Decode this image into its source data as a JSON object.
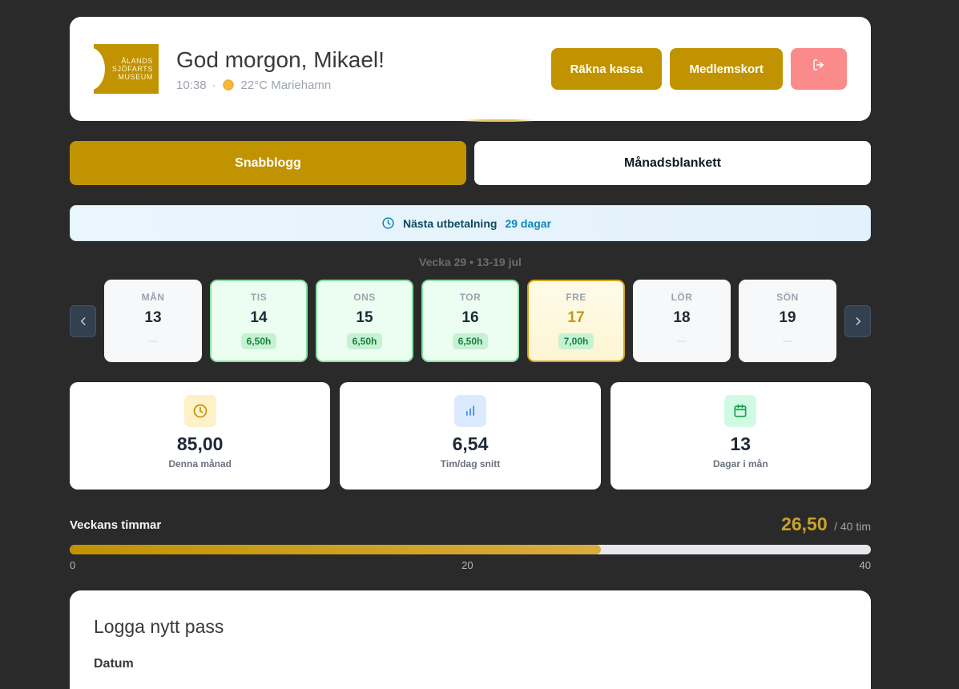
{
  "header": {
    "logo_lines": [
      "ÅLANDS",
      "SJÖFARTS",
      "MUSEUM"
    ],
    "greeting": "God morgon, Mikael!",
    "time": "10:38",
    "separator": "·",
    "weather": "22°C Mariehamn",
    "weather_icon": "sun-icon",
    "buttons": {
      "count_register": "Räkna kassa",
      "member_card": "Medlemskort"
    },
    "logout_icon": "logout-icon"
  },
  "tabs": [
    {
      "label": "Snabblogg",
      "active": true
    },
    {
      "label": "Månadsblankett",
      "active": false
    }
  ],
  "payout": {
    "label": "Nästa utbetalning",
    "days": "29 dagar"
  },
  "week": {
    "title": "Vecka 29 • 13-19 jul",
    "days": [
      {
        "name": "MÅN",
        "num": "13",
        "hours": "",
        "state": "empty",
        "empty": "—"
      },
      {
        "name": "TIS",
        "num": "14",
        "hours": "6,50h",
        "state": "logged",
        "empty": ""
      },
      {
        "name": "ONS",
        "num": "15",
        "hours": "6,50h",
        "state": "logged",
        "empty": ""
      },
      {
        "name": "TOR",
        "num": "16",
        "hours": "6,50h",
        "state": "logged",
        "empty": ""
      },
      {
        "name": "FRE",
        "num": "17",
        "hours": "7,00h",
        "state": "today",
        "empty": ""
      },
      {
        "name": "LÖR",
        "num": "18",
        "hours": "",
        "state": "empty",
        "empty": "—"
      },
      {
        "name": "SÖN",
        "num": "19",
        "hours": "",
        "state": "empty",
        "empty": "—"
      }
    ]
  },
  "stats": [
    {
      "value": "85,00",
      "label": "Denna månad",
      "icon": "clock-icon",
      "icon_bg": "#fdf1c7",
      "icon_color": "#c19300"
    },
    {
      "value": "6,54",
      "label": "Tim/dag snitt",
      "icon": "bar-chart-icon",
      "icon_bg": "#dbeafe",
      "icon_color": "#3b82f6"
    },
    {
      "value": "13",
      "label": "Dagar i mån",
      "icon": "calendar-icon",
      "icon_bg": "#d1fae5",
      "icon_color": "#16a34a"
    }
  ],
  "week_hours": {
    "title": "Veckans timmar",
    "total": "26,50",
    "of": "/ 40 tim",
    "fraction": 0.6625,
    "ticks": [
      "0",
      "20",
      "40"
    ]
  },
  "log": {
    "title": "Logga nytt pass",
    "date_label": "Datum"
  },
  "colors": {
    "accent": "#c19300",
    "background": "#2a2a2a",
    "logout": "#fb8a8a"
  }
}
